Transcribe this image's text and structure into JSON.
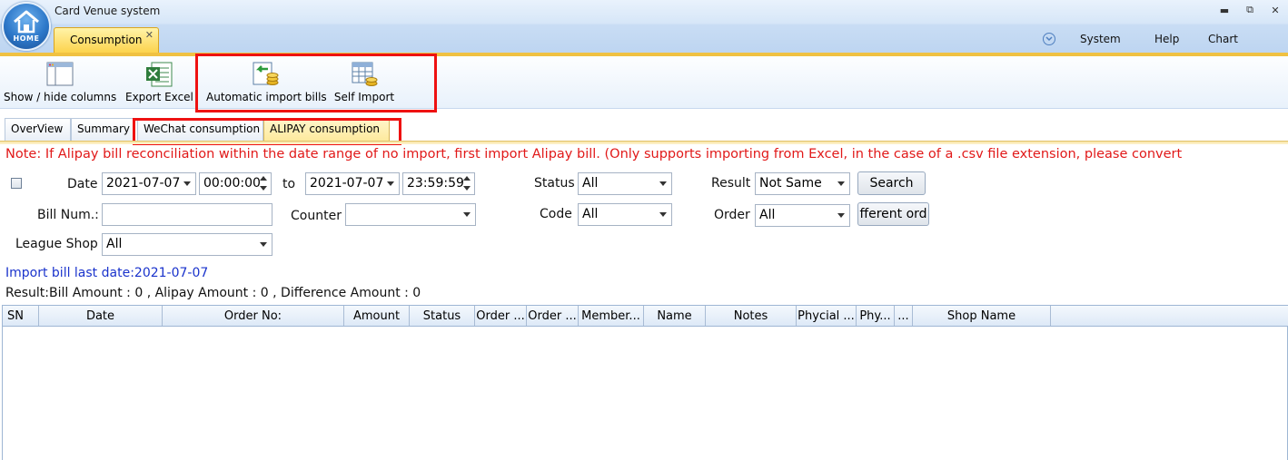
{
  "app": {
    "title": "Card Venue system",
    "logo_text": "HOME"
  },
  "window_controls": {
    "minimize": "▬",
    "restore": "⧉",
    "close": "✕"
  },
  "doc_tab": {
    "label": "Consumption",
    "close": "✕"
  },
  "menu": {
    "system": "System",
    "help": "Help",
    "chart": "Chart"
  },
  "toolbar": {
    "show_hide": "Show / hide columns",
    "export_excel": "Export Excel",
    "auto_import": "Automatic import bills",
    "self_import": "Self Import"
  },
  "tabs": [
    {
      "label": "OverView"
    },
    {
      "label": "Summary"
    },
    {
      "label": "WeChat consumption"
    },
    {
      "label": "ALIPAY consumption"
    }
  ],
  "active_tab": "ALIPAY consumption",
  "note": "Note: If Alipay bill reconciliation within the date range of no import, first import Alipay bill. (Only supports importing from Excel, in the case of a .csv file extension, please convert",
  "filters": {
    "date_label": "Date",
    "date_from": "2021-07-07",
    "time_from": "00:00:00",
    "to_label": "to",
    "date_to": "2021-07-07",
    "time_to": "23:59:59",
    "bill_num_label": "Bill Num.:",
    "bill_num_value": "",
    "counter_label": "Counter",
    "counter_value": "",
    "league_shop_label": "League Shop",
    "league_shop_value": "All",
    "status_label": "Status",
    "status_value": "All",
    "code_label": "Code",
    "code_value": "All",
    "result_label": "Result",
    "result_value": "Not Same",
    "order_label": "Order",
    "order_value": "All",
    "search_button": "Search",
    "diff_button": "fferent ord"
  },
  "import_info": "Import bill last date:2021-07-07",
  "result_summary": "Result:Bill Amount : 0 , Alipay Amount : 0 , Difference Amount : 0",
  "table": {
    "columns": [
      "SN",
      "Date",
      "Order No:",
      "Amount",
      "Status",
      "Order ...",
      "Order ...",
      "Member...",
      "Name",
      "Notes",
      "Phycial ...",
      "Phy...",
      "...",
      "Shop Name"
    ],
    "rows": []
  },
  "colors": {
    "note": "#e11919",
    "import_info": "#1a33cc",
    "highlight_box": "#ee1111",
    "active_tab": "#fcd34d"
  }
}
